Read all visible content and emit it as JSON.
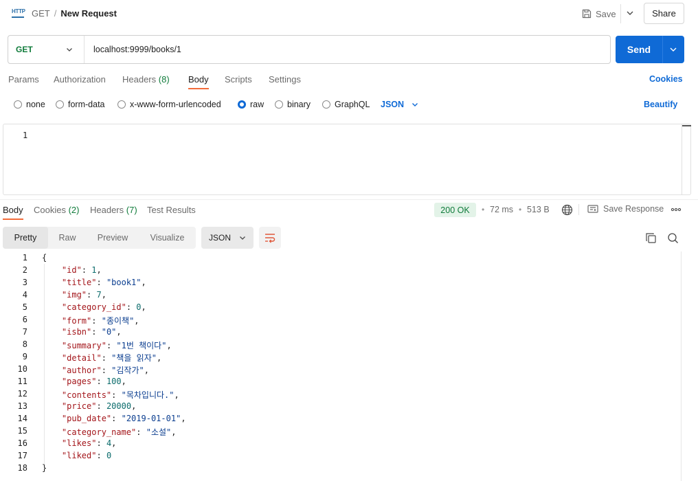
{
  "header": {
    "method": "GET",
    "separator": "/",
    "request_name": "New Request",
    "save_label": "Save",
    "share_label": "Share",
    "http_icon_text": "HTTP"
  },
  "request": {
    "method": "GET",
    "url": "localhost:9999/books/1",
    "send_label": "Send"
  },
  "request_tabs": {
    "params": "Params",
    "authorization": "Authorization",
    "headers": "Headers",
    "headers_count": "(8)",
    "body": "Body",
    "scripts": "Scripts",
    "settings": "Settings",
    "cookies": "Cookies",
    "active": "Body"
  },
  "body_types": {
    "none": "none",
    "form_data": "form-data",
    "urlencoded": "x-www-form-urlencoded",
    "raw": "raw",
    "binary": "binary",
    "graphql": "GraphQL",
    "selected": "raw",
    "format": "JSON",
    "beautify": "Beautify"
  },
  "request_editor": {
    "line_numbers": [
      "1"
    ]
  },
  "response_tabs": {
    "body": "Body",
    "cookies": "Cookies",
    "cookies_count": "(2)",
    "headers": "Headers",
    "headers_count": "(7)",
    "test_results": "Test Results",
    "active": "Body"
  },
  "response_status": {
    "status": "200 OK",
    "time": "72 ms",
    "size": "513 B",
    "bullet": "•",
    "save_response": "Save Response"
  },
  "viewer": {
    "modes": [
      "Pretty",
      "Raw",
      "Preview",
      "Visualize"
    ],
    "active_mode": "Pretty",
    "format": "JSON"
  },
  "response_body": [
    {
      "num": "1",
      "segments": [
        {
          "t": "p",
          "v": "{"
        }
      ]
    },
    {
      "num": "2",
      "segments": [
        {
          "t": "p",
          "v": "    "
        },
        {
          "t": "k",
          "v": "\"id\""
        },
        {
          "t": "p",
          "v": ": "
        },
        {
          "t": "n",
          "v": "1"
        },
        {
          "t": "p",
          "v": ","
        }
      ]
    },
    {
      "num": "3",
      "segments": [
        {
          "t": "p",
          "v": "    "
        },
        {
          "t": "k",
          "v": "\"title\""
        },
        {
          "t": "p",
          "v": ": "
        },
        {
          "t": "s",
          "v": "\"book1\""
        },
        {
          "t": "p",
          "v": ","
        }
      ]
    },
    {
      "num": "4",
      "segments": [
        {
          "t": "p",
          "v": "    "
        },
        {
          "t": "k",
          "v": "\"img\""
        },
        {
          "t": "p",
          "v": ": "
        },
        {
          "t": "n",
          "v": "7"
        },
        {
          "t": "p",
          "v": ","
        }
      ]
    },
    {
      "num": "5",
      "segments": [
        {
          "t": "p",
          "v": "    "
        },
        {
          "t": "k",
          "v": "\"category_id\""
        },
        {
          "t": "p",
          "v": ": "
        },
        {
          "t": "n",
          "v": "0"
        },
        {
          "t": "p",
          "v": ","
        }
      ]
    },
    {
      "num": "6",
      "segments": [
        {
          "t": "p",
          "v": "    "
        },
        {
          "t": "k",
          "v": "\"form\""
        },
        {
          "t": "p",
          "v": ": "
        },
        {
          "t": "s",
          "v": "\"종이책\""
        },
        {
          "t": "p",
          "v": ","
        }
      ]
    },
    {
      "num": "7",
      "segments": [
        {
          "t": "p",
          "v": "    "
        },
        {
          "t": "k",
          "v": "\"isbn\""
        },
        {
          "t": "p",
          "v": ": "
        },
        {
          "t": "s",
          "v": "\"0\""
        },
        {
          "t": "p",
          "v": ","
        }
      ]
    },
    {
      "num": "8",
      "segments": [
        {
          "t": "p",
          "v": "    "
        },
        {
          "t": "k",
          "v": "\"summary\""
        },
        {
          "t": "p",
          "v": ": "
        },
        {
          "t": "s",
          "v": "\"1번 책이다\""
        },
        {
          "t": "p",
          "v": ","
        }
      ]
    },
    {
      "num": "9",
      "segments": [
        {
          "t": "p",
          "v": "    "
        },
        {
          "t": "k",
          "v": "\"detail\""
        },
        {
          "t": "p",
          "v": ": "
        },
        {
          "t": "s",
          "v": "\"책을 읽자\""
        },
        {
          "t": "p",
          "v": ","
        }
      ]
    },
    {
      "num": "10",
      "segments": [
        {
          "t": "p",
          "v": "    "
        },
        {
          "t": "k",
          "v": "\"author\""
        },
        {
          "t": "p",
          "v": ": "
        },
        {
          "t": "s",
          "v": "\"김작가\""
        },
        {
          "t": "p",
          "v": ","
        }
      ]
    },
    {
      "num": "11",
      "segments": [
        {
          "t": "p",
          "v": "    "
        },
        {
          "t": "k",
          "v": "\"pages\""
        },
        {
          "t": "p",
          "v": ": "
        },
        {
          "t": "n",
          "v": "100"
        },
        {
          "t": "p",
          "v": ","
        }
      ]
    },
    {
      "num": "12",
      "segments": [
        {
          "t": "p",
          "v": "    "
        },
        {
          "t": "k",
          "v": "\"contents\""
        },
        {
          "t": "p",
          "v": ": "
        },
        {
          "t": "s",
          "v": "\"목차입니다.\""
        },
        {
          "t": "p",
          "v": ","
        }
      ]
    },
    {
      "num": "13",
      "segments": [
        {
          "t": "p",
          "v": "    "
        },
        {
          "t": "k",
          "v": "\"price\""
        },
        {
          "t": "p",
          "v": ": "
        },
        {
          "t": "n",
          "v": "20000"
        },
        {
          "t": "p",
          "v": ","
        }
      ]
    },
    {
      "num": "14",
      "segments": [
        {
          "t": "p",
          "v": "    "
        },
        {
          "t": "k",
          "v": "\"pub_date\""
        },
        {
          "t": "p",
          "v": ": "
        },
        {
          "t": "s",
          "v": "\"2019-01-01\""
        },
        {
          "t": "p",
          "v": ","
        }
      ]
    },
    {
      "num": "15",
      "segments": [
        {
          "t": "p",
          "v": "    "
        },
        {
          "t": "k",
          "v": "\"category_name\""
        },
        {
          "t": "p",
          "v": ": "
        },
        {
          "t": "s",
          "v": "\"소설\""
        },
        {
          "t": "p",
          "v": ","
        }
      ]
    },
    {
      "num": "16",
      "segments": [
        {
          "t": "p",
          "v": "    "
        },
        {
          "t": "k",
          "v": "\"likes\""
        },
        {
          "t": "p",
          "v": ": "
        },
        {
          "t": "n",
          "v": "4"
        },
        {
          "t": "p",
          "v": ","
        }
      ]
    },
    {
      "num": "17",
      "segments": [
        {
          "t": "p",
          "v": "    "
        },
        {
          "t": "k",
          "v": "\"liked\""
        },
        {
          "t": "p",
          "v": ": "
        },
        {
          "t": "n",
          "v": "0"
        }
      ]
    },
    {
      "num": "18",
      "segments": [
        {
          "t": "p",
          "v": "}"
        }
      ]
    }
  ],
  "colors": {
    "accent_blue": "#0f6ad6",
    "tab_underline": "#f26b3a",
    "method_green": "#0f7b3a",
    "status_bg": "#e3f3e8",
    "json_key": "#a3151a",
    "json_string": "#0a3d8f",
    "json_number": "#0a6b6b"
  },
  "icons": {
    "http": "http-icon",
    "save": "save-icon",
    "globe": "globe-icon",
    "save_response": "save-response-icon",
    "more": "more-icon",
    "wrap": "wrap-lines-icon",
    "copy": "copy-icon",
    "search": "search-icon"
  }
}
